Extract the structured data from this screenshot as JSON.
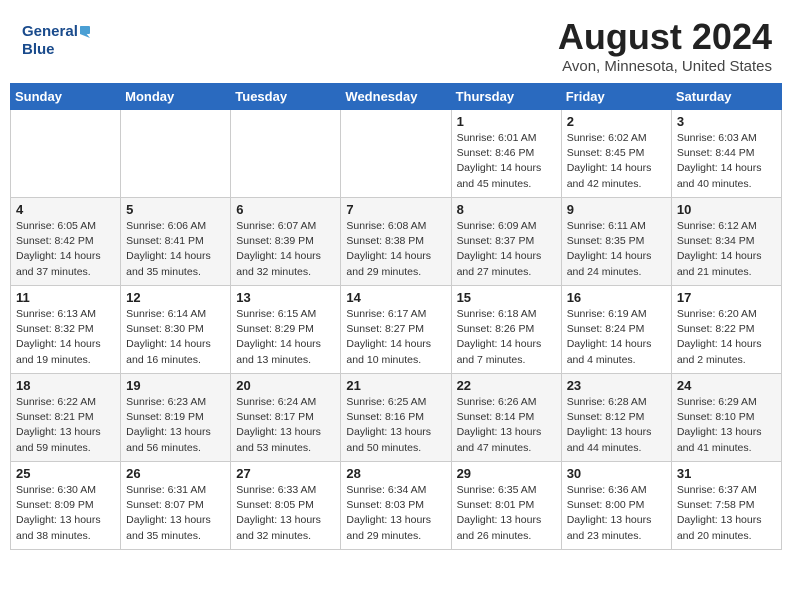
{
  "header": {
    "logo_line1": "General",
    "logo_line2": "Blue",
    "month": "August 2024",
    "location": "Avon, Minnesota, United States"
  },
  "days_of_week": [
    "Sunday",
    "Monday",
    "Tuesday",
    "Wednesday",
    "Thursday",
    "Friday",
    "Saturday"
  ],
  "weeks": [
    [
      {
        "day": "",
        "info": ""
      },
      {
        "day": "",
        "info": ""
      },
      {
        "day": "",
        "info": ""
      },
      {
        "day": "",
        "info": ""
      },
      {
        "day": "1",
        "info": "Sunrise: 6:01 AM\nSunset: 8:46 PM\nDaylight: 14 hours\nand 45 minutes."
      },
      {
        "day": "2",
        "info": "Sunrise: 6:02 AM\nSunset: 8:45 PM\nDaylight: 14 hours\nand 42 minutes."
      },
      {
        "day": "3",
        "info": "Sunrise: 6:03 AM\nSunset: 8:44 PM\nDaylight: 14 hours\nand 40 minutes."
      }
    ],
    [
      {
        "day": "4",
        "info": "Sunrise: 6:05 AM\nSunset: 8:42 PM\nDaylight: 14 hours\nand 37 minutes."
      },
      {
        "day": "5",
        "info": "Sunrise: 6:06 AM\nSunset: 8:41 PM\nDaylight: 14 hours\nand 35 minutes."
      },
      {
        "day": "6",
        "info": "Sunrise: 6:07 AM\nSunset: 8:39 PM\nDaylight: 14 hours\nand 32 minutes."
      },
      {
        "day": "7",
        "info": "Sunrise: 6:08 AM\nSunset: 8:38 PM\nDaylight: 14 hours\nand 29 minutes."
      },
      {
        "day": "8",
        "info": "Sunrise: 6:09 AM\nSunset: 8:37 PM\nDaylight: 14 hours\nand 27 minutes."
      },
      {
        "day": "9",
        "info": "Sunrise: 6:11 AM\nSunset: 8:35 PM\nDaylight: 14 hours\nand 24 minutes."
      },
      {
        "day": "10",
        "info": "Sunrise: 6:12 AM\nSunset: 8:34 PM\nDaylight: 14 hours\nand 21 minutes."
      }
    ],
    [
      {
        "day": "11",
        "info": "Sunrise: 6:13 AM\nSunset: 8:32 PM\nDaylight: 14 hours\nand 19 minutes."
      },
      {
        "day": "12",
        "info": "Sunrise: 6:14 AM\nSunset: 8:30 PM\nDaylight: 14 hours\nand 16 minutes."
      },
      {
        "day": "13",
        "info": "Sunrise: 6:15 AM\nSunset: 8:29 PM\nDaylight: 14 hours\nand 13 minutes."
      },
      {
        "day": "14",
        "info": "Sunrise: 6:17 AM\nSunset: 8:27 PM\nDaylight: 14 hours\nand 10 minutes."
      },
      {
        "day": "15",
        "info": "Sunrise: 6:18 AM\nSunset: 8:26 PM\nDaylight: 14 hours\nand 7 minutes."
      },
      {
        "day": "16",
        "info": "Sunrise: 6:19 AM\nSunset: 8:24 PM\nDaylight: 14 hours\nand 4 minutes."
      },
      {
        "day": "17",
        "info": "Sunrise: 6:20 AM\nSunset: 8:22 PM\nDaylight: 14 hours\nand 2 minutes."
      }
    ],
    [
      {
        "day": "18",
        "info": "Sunrise: 6:22 AM\nSunset: 8:21 PM\nDaylight: 13 hours\nand 59 minutes."
      },
      {
        "day": "19",
        "info": "Sunrise: 6:23 AM\nSunset: 8:19 PM\nDaylight: 13 hours\nand 56 minutes."
      },
      {
        "day": "20",
        "info": "Sunrise: 6:24 AM\nSunset: 8:17 PM\nDaylight: 13 hours\nand 53 minutes."
      },
      {
        "day": "21",
        "info": "Sunrise: 6:25 AM\nSunset: 8:16 PM\nDaylight: 13 hours\nand 50 minutes."
      },
      {
        "day": "22",
        "info": "Sunrise: 6:26 AM\nSunset: 8:14 PM\nDaylight: 13 hours\nand 47 minutes."
      },
      {
        "day": "23",
        "info": "Sunrise: 6:28 AM\nSunset: 8:12 PM\nDaylight: 13 hours\nand 44 minutes."
      },
      {
        "day": "24",
        "info": "Sunrise: 6:29 AM\nSunset: 8:10 PM\nDaylight: 13 hours\nand 41 minutes."
      }
    ],
    [
      {
        "day": "25",
        "info": "Sunrise: 6:30 AM\nSunset: 8:09 PM\nDaylight: 13 hours\nand 38 minutes."
      },
      {
        "day": "26",
        "info": "Sunrise: 6:31 AM\nSunset: 8:07 PM\nDaylight: 13 hours\nand 35 minutes."
      },
      {
        "day": "27",
        "info": "Sunrise: 6:33 AM\nSunset: 8:05 PM\nDaylight: 13 hours\nand 32 minutes."
      },
      {
        "day": "28",
        "info": "Sunrise: 6:34 AM\nSunset: 8:03 PM\nDaylight: 13 hours\nand 29 minutes."
      },
      {
        "day": "29",
        "info": "Sunrise: 6:35 AM\nSunset: 8:01 PM\nDaylight: 13 hours\nand 26 minutes."
      },
      {
        "day": "30",
        "info": "Sunrise: 6:36 AM\nSunset: 8:00 PM\nDaylight: 13 hours\nand 23 minutes."
      },
      {
        "day": "31",
        "info": "Sunrise: 6:37 AM\nSunset: 7:58 PM\nDaylight: 13 hours\nand 20 minutes."
      }
    ]
  ]
}
